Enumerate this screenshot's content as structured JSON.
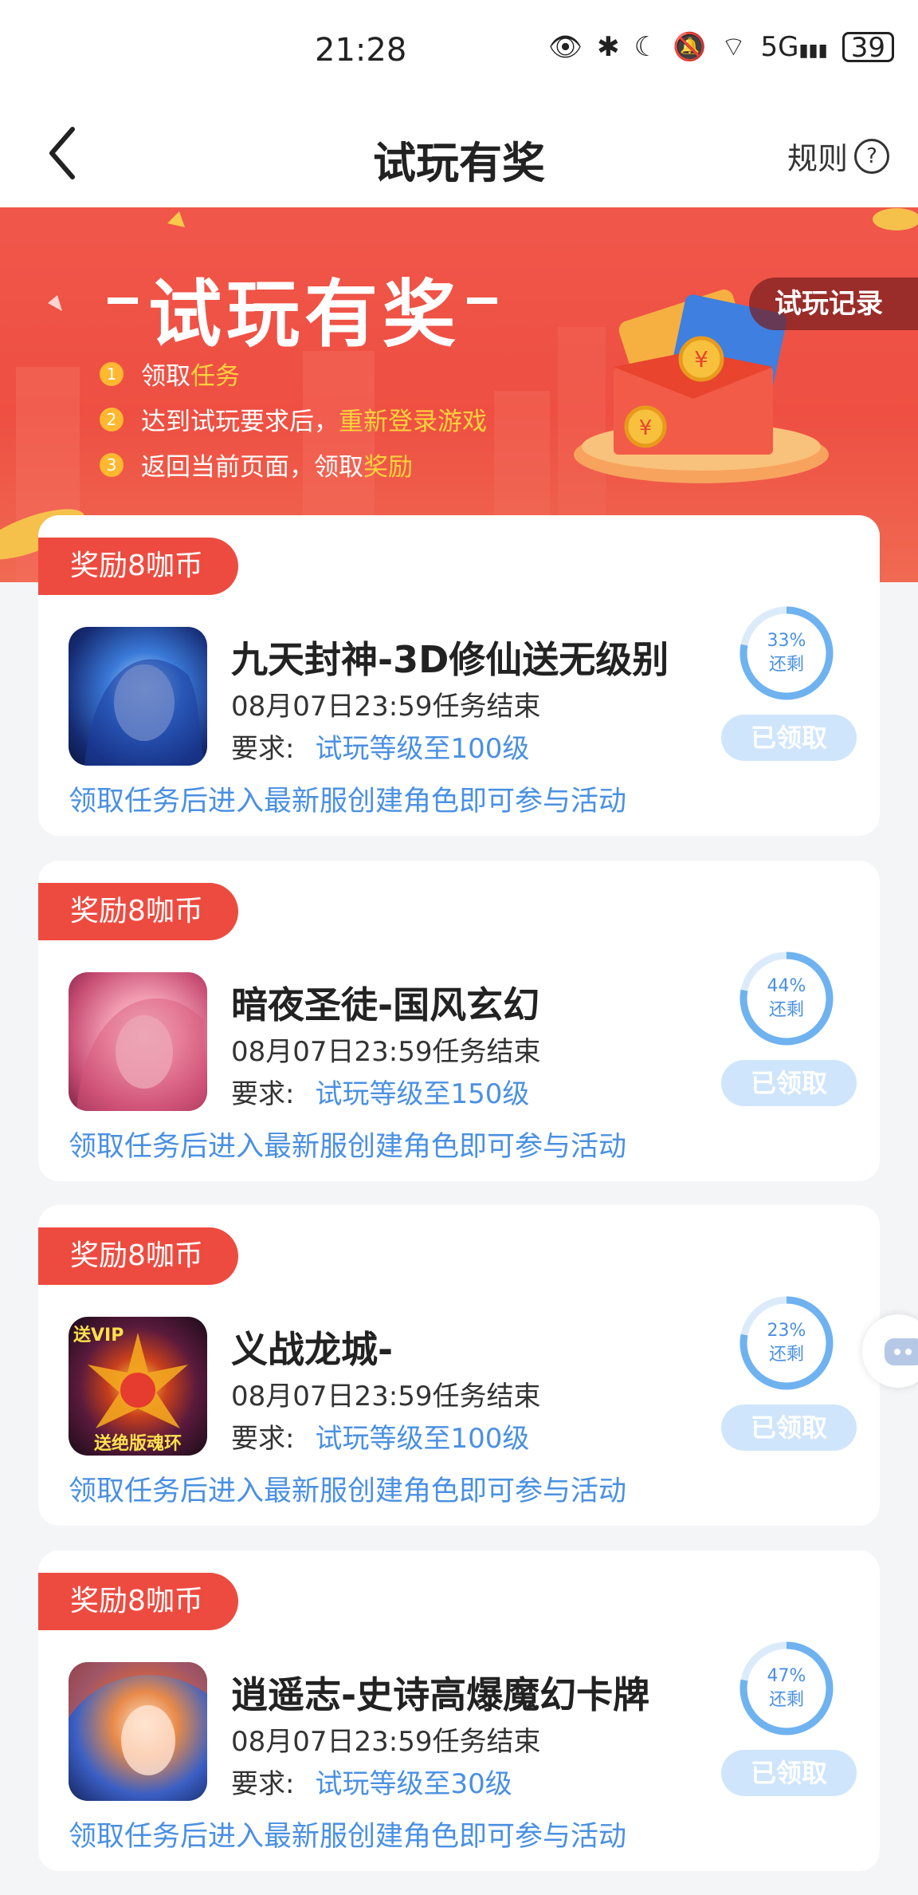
{
  "status_bar": {
    "time": "21:28",
    "battery": "39",
    "network": "5G"
  },
  "nav": {
    "title": "试玩有奖",
    "rules_label": "规则"
  },
  "banner": {
    "title": "试玩有奖",
    "record_button": "试玩记录",
    "steps": [
      {
        "num": "1",
        "text": "领取",
        "highlight": "任务"
      },
      {
        "num": "2",
        "text": "达到试玩要求后，",
        "highlight": "重新登录游戏"
      },
      {
        "num": "3",
        "text": "返回当前页面，领取",
        "highlight": "奖励"
      }
    ]
  },
  "tasks": [
    {
      "reward": "奖励8咖币",
      "name": "九天封神-3D修仙送无级别",
      "deadline": "08月07日23:59任务结束",
      "req_label": "要求:",
      "req_value": "试玩等级至100级",
      "note": "领取任务后进入最新服创建角色即可参与活动",
      "remaining_pct": "33%",
      "remaining_label": "还剩",
      "remaining_fraction": 0.33,
      "status": "已领取"
    },
    {
      "reward": "奖励8咖币",
      "name": "暗夜圣徒-国风玄幻",
      "deadline": "08月07日23:59任务结束",
      "req_label": "要求:",
      "req_value": "试玩等级至150级",
      "note": "领取任务后进入最新服创建角色即可参与活动",
      "remaining_pct": "44%",
      "remaining_label": "还剩",
      "remaining_fraction": 0.44,
      "status": "已领取"
    },
    {
      "reward": "奖励8咖币",
      "name": "义战龙城-",
      "deadline": "08月07日23:59任务结束",
      "req_label": "要求:",
      "req_value": "试玩等级至100级",
      "note": "领取任务后进入最新服创建角色即可参与活动",
      "remaining_pct": "23%",
      "remaining_label": "还剩",
      "remaining_fraction": 0.23,
      "status": "已领取",
      "icon_text_top": "送VIP",
      "icon_text_bottom": "送绝版魂环"
    },
    {
      "reward": "奖励8咖币",
      "name": "逍遥志-史诗高爆魔幻卡牌",
      "deadline": "08月07日23:59任务结束",
      "req_label": "要求:",
      "req_value": "试玩等级至30级",
      "note": "领取任务后进入最新服创建角色即可参与活动",
      "remaining_pct": "47%",
      "remaining_label": "还剩",
      "remaining_fraction": 0.47,
      "status": "已领取"
    }
  ]
}
